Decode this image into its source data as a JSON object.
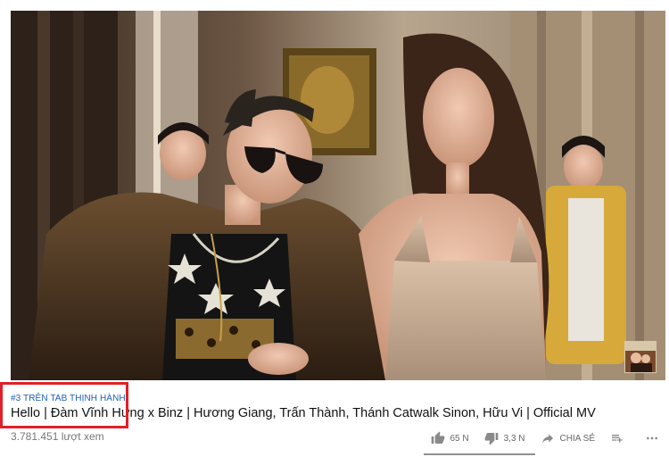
{
  "video": {
    "trending_badge": "#3 TRÊN TAB THỊNH HÀNH",
    "title": "Hello | Đàm Vĩnh Hưng x Binz | Hương Giang, Trấn Thành, Thánh Catwalk Sinon, Hữu Vi | Official MV",
    "views": "3.781.451 lượt xem"
  },
  "actions": {
    "like_count": "65 N",
    "dislike_count": "3,3 N",
    "share_label": "CHIA SẺ"
  },
  "icons": {
    "like": "thumbs-up-icon",
    "dislike": "thumbs-down-icon",
    "share": "share-arrow-icon",
    "add_to_playlist": "playlist-add-icon",
    "more": "more-horizontal-icon"
  },
  "colors": {
    "highlight_border": "#e0202a",
    "trending_text": "#1a5fb4"
  }
}
